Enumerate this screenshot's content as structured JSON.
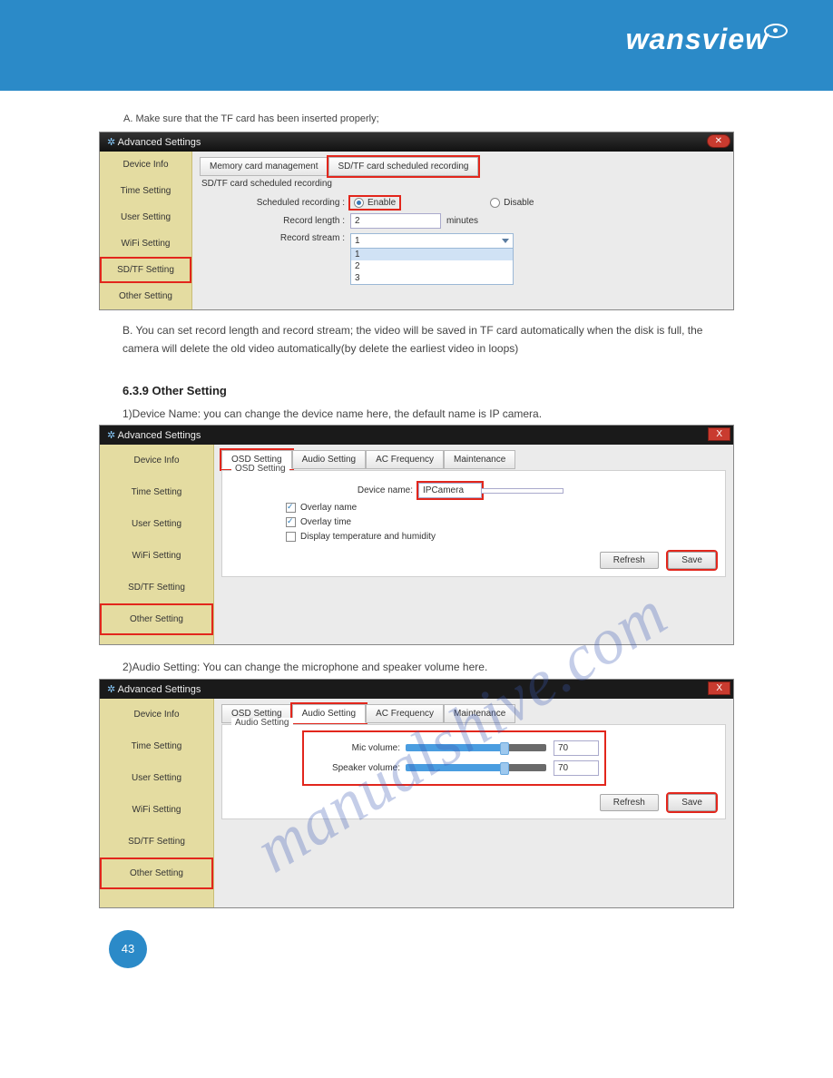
{
  "brand": "wansview",
  "page_number": "43",
  "watermark": "manualshive.com",
  "section_a": "A. Make sure that the TF card has been inserted properly;",
  "body_text_1": "B. You can set record length and record stream; the video will be saved in TF card automatically when the disk is full, the camera will delete the old video automatically(by delete the earliest video in loops)",
  "heading_639": "6.3.9 Other Setting",
  "step1": "1)Device Name: you can change the device name here, the default name is IP camera.",
  "step2": "2)Audio Setting: You can change the microphone and speaker volume here.",
  "win1": {
    "title": "Advanced Settings",
    "sidebar": [
      "Device Info",
      "Time Setting",
      "User Setting",
      "WiFi Setting",
      "SD/TF Setting",
      "Other Setting"
    ],
    "highlight_index": 4,
    "tabs": [
      "Memory card management",
      "SD/TF card scheduled recording"
    ],
    "panel_title": "SD/TF card scheduled recording",
    "rows": {
      "scheduled_label": "Scheduled recording :",
      "enable": "Enable",
      "disable": "Disable",
      "length_label": "Record length :",
      "length_value": "2",
      "length_unit": "minutes",
      "stream_label": "Record stream :",
      "stream_value": "1",
      "stream_options": [
        "1",
        "2",
        "3"
      ]
    }
  },
  "win2": {
    "title": "Advanced Settings",
    "sidebar": [
      "Device Info",
      "Time Setting",
      "User Setting",
      "WiFi Setting",
      "SD/TF Setting",
      "Other Setting"
    ],
    "highlight_index": 5,
    "tabs": [
      "OSD Setting",
      "Audio Setting",
      "AC Frequency",
      "Maintenance"
    ],
    "legend": "OSD Setting",
    "device_name_label": "Device name:",
    "device_name_value": "IPCamera",
    "overlay_name": "Overlay name",
    "overlay_time": "Overlay time",
    "display_temp": "Display temperature and humidity",
    "refresh": "Refresh",
    "save": "Save"
  },
  "win3": {
    "title": "Advanced Settings",
    "sidebar": [
      "Device Info",
      "Time Setting",
      "User Setting",
      "WiFi Setting",
      "SD/TF Setting",
      "Other Setting"
    ],
    "highlight_index": 5,
    "tabs": [
      "OSD Setting",
      "Audio Setting",
      "AC Frequency",
      "Maintenance"
    ],
    "legend": "Audio Setting",
    "mic_label": "Mic volume:",
    "mic_value": "70",
    "speaker_label": "Speaker volume:",
    "speaker_value": "70",
    "refresh": "Refresh",
    "save": "Save"
  }
}
